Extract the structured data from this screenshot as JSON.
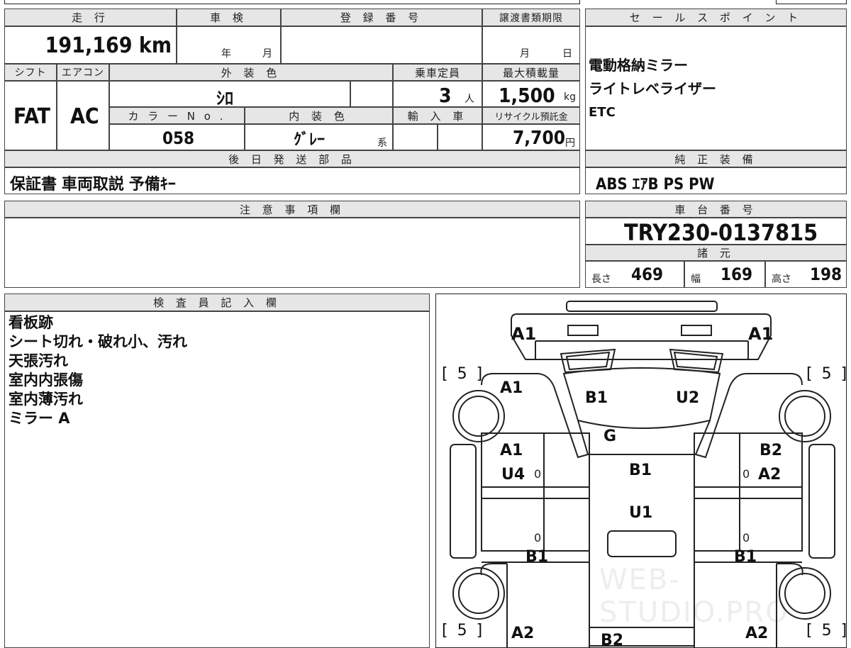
{
  "header": {
    "mileage_label": "走 行",
    "mileage_value": "191,169 km",
    "inspection_label": "車 検",
    "inspection_year_unit": "年",
    "inspection_month_unit": "月",
    "registration_label": "登 録 番 号",
    "transfer_label": "譲渡書類期限",
    "transfer_month_unit": "月",
    "transfer_day_unit": "日"
  },
  "specs": {
    "shift_label": "シフト",
    "shift_value": "FAT",
    "ac_label": "エアコン",
    "ac_value": "AC",
    "exterior_color_label": "外 装 色",
    "exterior_color_value": "ｼﾛ",
    "capacity_label": "乗車定員",
    "capacity_value": "3",
    "capacity_unit": "人",
    "max_load_label": "最大積載量",
    "max_load_value": "1,500",
    "max_load_unit": "kg",
    "color_no_label": "カ ラ ー N o .",
    "color_no_value": "058",
    "interior_color_label": "内 装 色",
    "interior_color_value": "ｸﾞﾚｰ",
    "interior_color_suffix": "系",
    "import_label": "輸 入 車",
    "recycle_label": "リサイクル預託金",
    "recycle_value": "7,700",
    "recycle_unit": "円"
  },
  "later_parts": {
    "label": "後 日 発 送 部 品",
    "value": "保証書 車両取説 予備ｷｰ"
  },
  "sales_points": {
    "label": "セ ー ル ス ポ イ ン ト",
    "items": [
      "電動格納ミラー",
      "ライトレベライザー",
      "ETC"
    ]
  },
  "genuine_equipment": {
    "label": "純 正 装 備",
    "value": "ABS ｴｱB PS PW"
  },
  "caution": {
    "label": "注 意 事 項 欄"
  },
  "chassis": {
    "label": "車 台 番 号",
    "value": "TRY230-0137815"
  },
  "dimensions": {
    "label": "諸 元",
    "length_label": "長さ",
    "length_value": "469",
    "width_label": "幅",
    "width_value": "169",
    "height_label": "高さ",
    "height_value": "198"
  },
  "inspector": {
    "label": "検 査 員 記 入 欄",
    "notes": [
      "看板跡",
      "シート切れ・破れ小、汚れ",
      "天張汚れ",
      "室内内張傷",
      "室内薄汚れ",
      "ミラー A"
    ]
  },
  "diagram": {
    "bracket_5": "[ 5 ]",
    "marks": {
      "front_left_top": "A1",
      "front_right_top": "A1",
      "front_left_fender": "A1",
      "hood_left": "B1",
      "hood_right": "U2",
      "grille": "G",
      "left_door_a1": "A1",
      "left_door_u4": "U4",
      "right_door_b2": "B2",
      "right_door_a2": "A2",
      "roof_b1": "B1",
      "roof_u1": "U1",
      "left_lower_b1": "B1",
      "right_lower_b1": "B1",
      "rear_left_a2": "A2",
      "rear_right_a2": "A2",
      "rear_center_b2": "B2",
      "zero_mark": "0"
    }
  },
  "watermark": "WEB-STUDIO.PRO"
}
